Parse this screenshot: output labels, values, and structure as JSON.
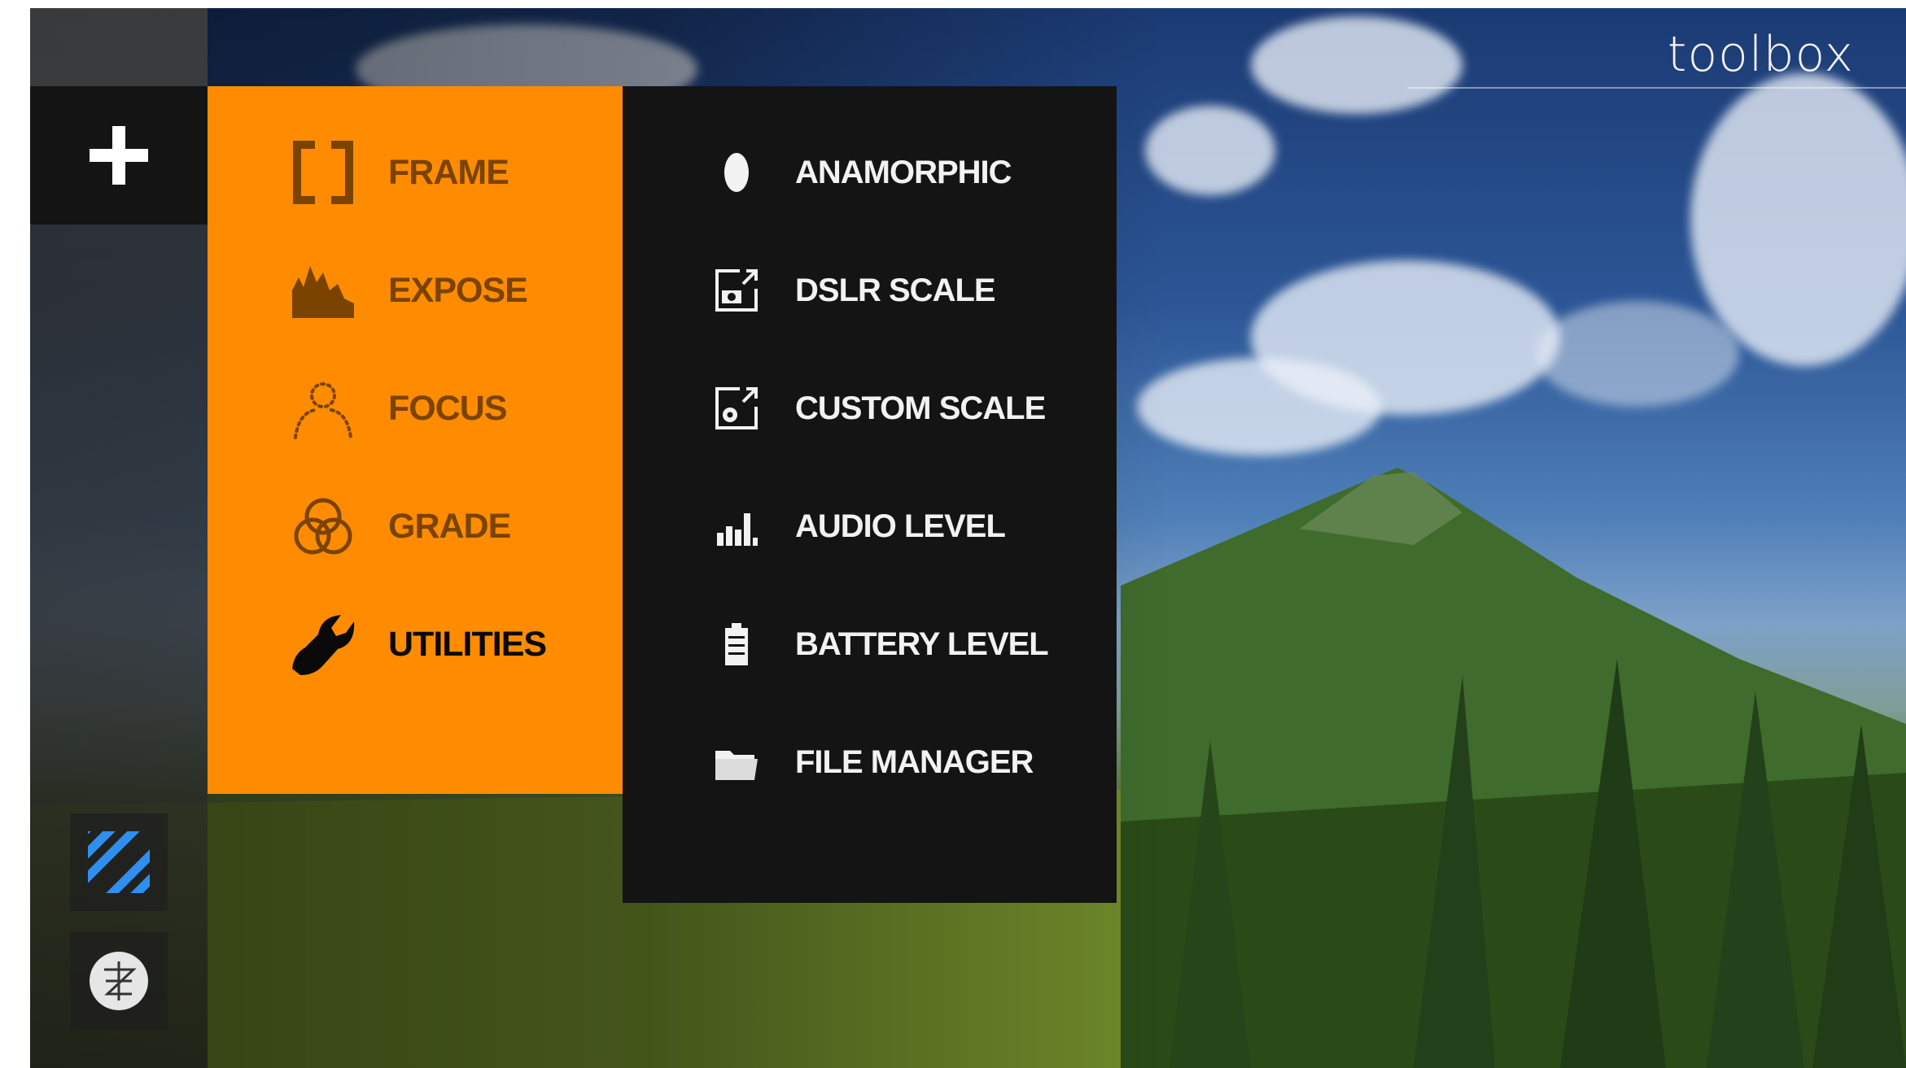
{
  "app": {
    "title": "toolbox"
  },
  "rail": {
    "add_icon": "plus-icon",
    "bottom_buttons": [
      {
        "icon": "striped-overlay-icon",
        "color": "#2e8ff0"
      },
      {
        "icon": "settings-knot-icon"
      }
    ]
  },
  "categories": [
    {
      "label": "FRAME",
      "icon": "bracket-frame-icon",
      "active": false
    },
    {
      "label": "EXPOSE",
      "icon": "histogram-icon",
      "active": false
    },
    {
      "label": "FOCUS",
      "icon": "focus-person-icon",
      "active": false
    },
    {
      "label": "GRADE",
      "icon": "color-circles-icon",
      "active": false
    },
    {
      "label": "UTILITIES",
      "icon": "wrench-icon",
      "active": true
    }
  ],
  "utilities": [
    {
      "label": "ANAMORPHIC",
      "icon": "oval-icon"
    },
    {
      "label": "DSLR SCALE",
      "icon": "camera-scale-icon"
    },
    {
      "label": "CUSTOM SCALE",
      "icon": "gear-scale-icon"
    },
    {
      "label": "AUDIO LEVEL",
      "icon": "audio-meter-icon"
    },
    {
      "label": "BATTERY LEVEL",
      "icon": "battery-icon"
    },
    {
      "label": "FILE MANAGER",
      "icon": "folder-icon"
    }
  ],
  "colors": {
    "accent": "#ff8c00",
    "category_text": "#7a4300",
    "active_text": "#0a0a0a",
    "panel_dark": "#141414",
    "text_light": "#f2f2f2"
  }
}
